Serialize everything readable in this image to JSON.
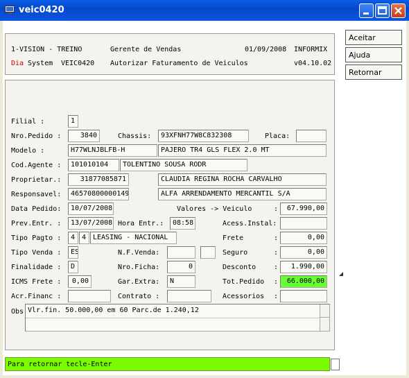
{
  "window": {
    "title": "veic0420"
  },
  "header": {
    "company": "1-VISION - TREINO",
    "app": "Gerente de Vendas",
    "date": "01/09/2008",
    "db": "INFORMIX",
    "dia": "Dia",
    "system": "System",
    "program": "VEIC0420",
    "description": "Autorizar Faturamento de Veiculos",
    "version": "v04.10.02"
  },
  "side_buttons": {
    "accept": "Aceitar",
    "help": "Ajuda",
    "return": "Retornar"
  },
  "labels": {
    "filial": "Filial    :",
    "nro_pedido": "Nro.Pedido :",
    "chassis": "Chassis:",
    "placa": "Placa:",
    "modelo": "Modelo     :",
    "cod_agente": "Cod.Agente :",
    "proprietario": "Proprietar.:",
    "responsavel": "Responsavel:",
    "data_pedido": "Data Pedido:",
    "valores": "Valores -> Veiculo",
    "prev_entr": "Prev.Entr. :",
    "hora_entr": "Hora Entr.:",
    "acess_instal": "Acess.Instal:",
    "tipo_pagto": "Tipo Pagto :",
    "frete": "Frete",
    "tipo_venda": "Tipo Venda :",
    "nf_venda": "N.F.Venda:",
    "seguro": "Seguro",
    "finalidade": "Finalidade :",
    "nro_ficha": "Nro.Ficha:",
    "desconto": "Desconto",
    "icms_frete": "ICMS Frete :",
    "gar_extra": "Gar.Extra:",
    "tot_pedido": "Tot.Pedido",
    "acr_financ": "Acr.Financ :",
    "contrato": "Contrato :",
    "acessorios": "Acessorios",
    "obs": "Obs",
    "colon": ":"
  },
  "values": {
    "filial": "1",
    "nro_pedido": "3840",
    "chassis": "93XFNH77W8C832308",
    "placa": "",
    "modelo_code": "H77WLNJBLFB-H",
    "modelo_desc": "PAJERO TR4 GLS FLEX 2.0 MT",
    "cod_agente": "101010104",
    "agente_nome": "TOLENTINO SOUSA RODR",
    "proprietario_cpf": "31877085871",
    "proprietario_nome": "CLAUDIA REGINA ROCHA CARVALHO",
    "responsavel_cnpj": "46570800000149",
    "responsavel_nome": "ALFA ARRENDAMENTO MERCANTIL S/A",
    "data_pedido": "10/07/2008",
    "veiculo": "67.990,00",
    "prev_entr": "13/07/2008",
    "hora_entr": "08:58",
    "acess_instal": "",
    "tipo_pagto_a": "4",
    "tipo_pagto_b": "4",
    "tipo_pagto_desc": "LEASING - NACIONAL",
    "frete": "0,00",
    "tipo_venda": "ES",
    "nf_venda": "",
    "nf_venda_b": "",
    "seguro": "0,00",
    "finalidade": "D",
    "nro_ficha": "0",
    "desconto": "1.990,00",
    "icms_frete": "0,00",
    "gar_extra": "N",
    "tot_pedido": "66.000,00",
    "acr_financ": "",
    "contrato": "",
    "acessorios": "",
    "obs": "Vlr.fin. 50.000,00 em 60 Parc.de 1.240,12"
  },
  "status": {
    "message": "Para retornar tecle-Enter"
  },
  "colors": {
    "title_bar": "#0a56e0",
    "status_bg": "#7cfc00",
    "highlight": "#66ff33",
    "dia_text": "#cc0000"
  }
}
